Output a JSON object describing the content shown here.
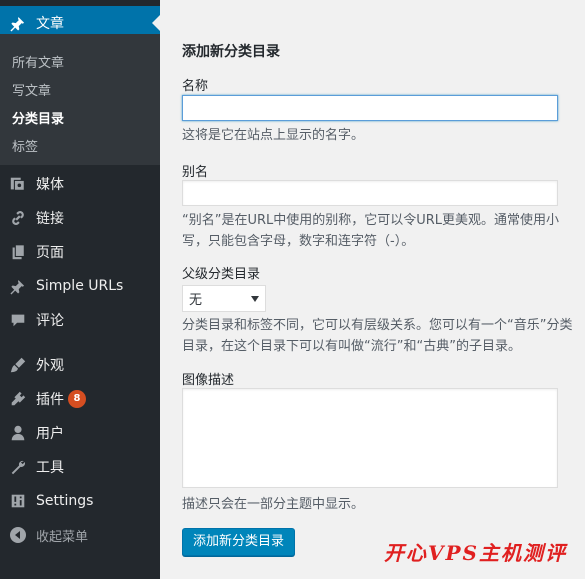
{
  "sidebar": {
    "posts": {
      "label": "文章",
      "submenu": [
        "所有文章",
        "写文章",
        "分类目录",
        "标签"
      ]
    },
    "items": [
      {
        "label": "媒体",
        "icon": "media-icon"
      },
      {
        "label": "链接",
        "icon": "link-icon"
      },
      {
        "label": "页面",
        "icon": "page-icon"
      },
      {
        "label": "Simple URLs",
        "icon": "pin-icon"
      },
      {
        "label": "评论",
        "icon": "comment-icon"
      },
      {
        "label": "外观",
        "icon": "appearance-icon"
      },
      {
        "label": "插件",
        "icon": "plugin-icon",
        "badge": "8"
      },
      {
        "label": "用户",
        "icon": "user-icon"
      },
      {
        "label": "工具",
        "icon": "wrench-icon"
      },
      {
        "label": "Settings",
        "icon": "settings-icon"
      },
      {
        "label": "收起菜单",
        "icon": "collapse-icon"
      }
    ]
  },
  "form": {
    "heading": "添加新分类目录",
    "name_label": "名称",
    "name_value": "",
    "name_desc": "这将是它在站点上显示的名字。",
    "slug_label": "别名",
    "slug_value": "",
    "slug_desc": "“别名”是在URL中使用的别称，它可以令URL更美观。通常使用小写，只能包含字母，数字和连字符（-）。",
    "parent_label": "父级分类目录",
    "parent_value": "无",
    "parent_desc": "分类目录和标签不同，它可以有层级关系。您可以有一个“音乐”分类目录，在这个目录下可以有叫做“流行”和“古典”的子目录。",
    "image_desc_label": "图像描述",
    "description_help": "描述只会在一部分主题中显示。",
    "submit_label": "添加新分类目录"
  },
  "watermark": "开心VPS主机测评",
  "colors": {
    "sidebar_bg": "#23282d",
    "submenu_bg": "#32373c",
    "accent": "#0073aa",
    "button": "#0085ba",
    "badge": "#d54e21",
    "watermark": "#e02020"
  }
}
